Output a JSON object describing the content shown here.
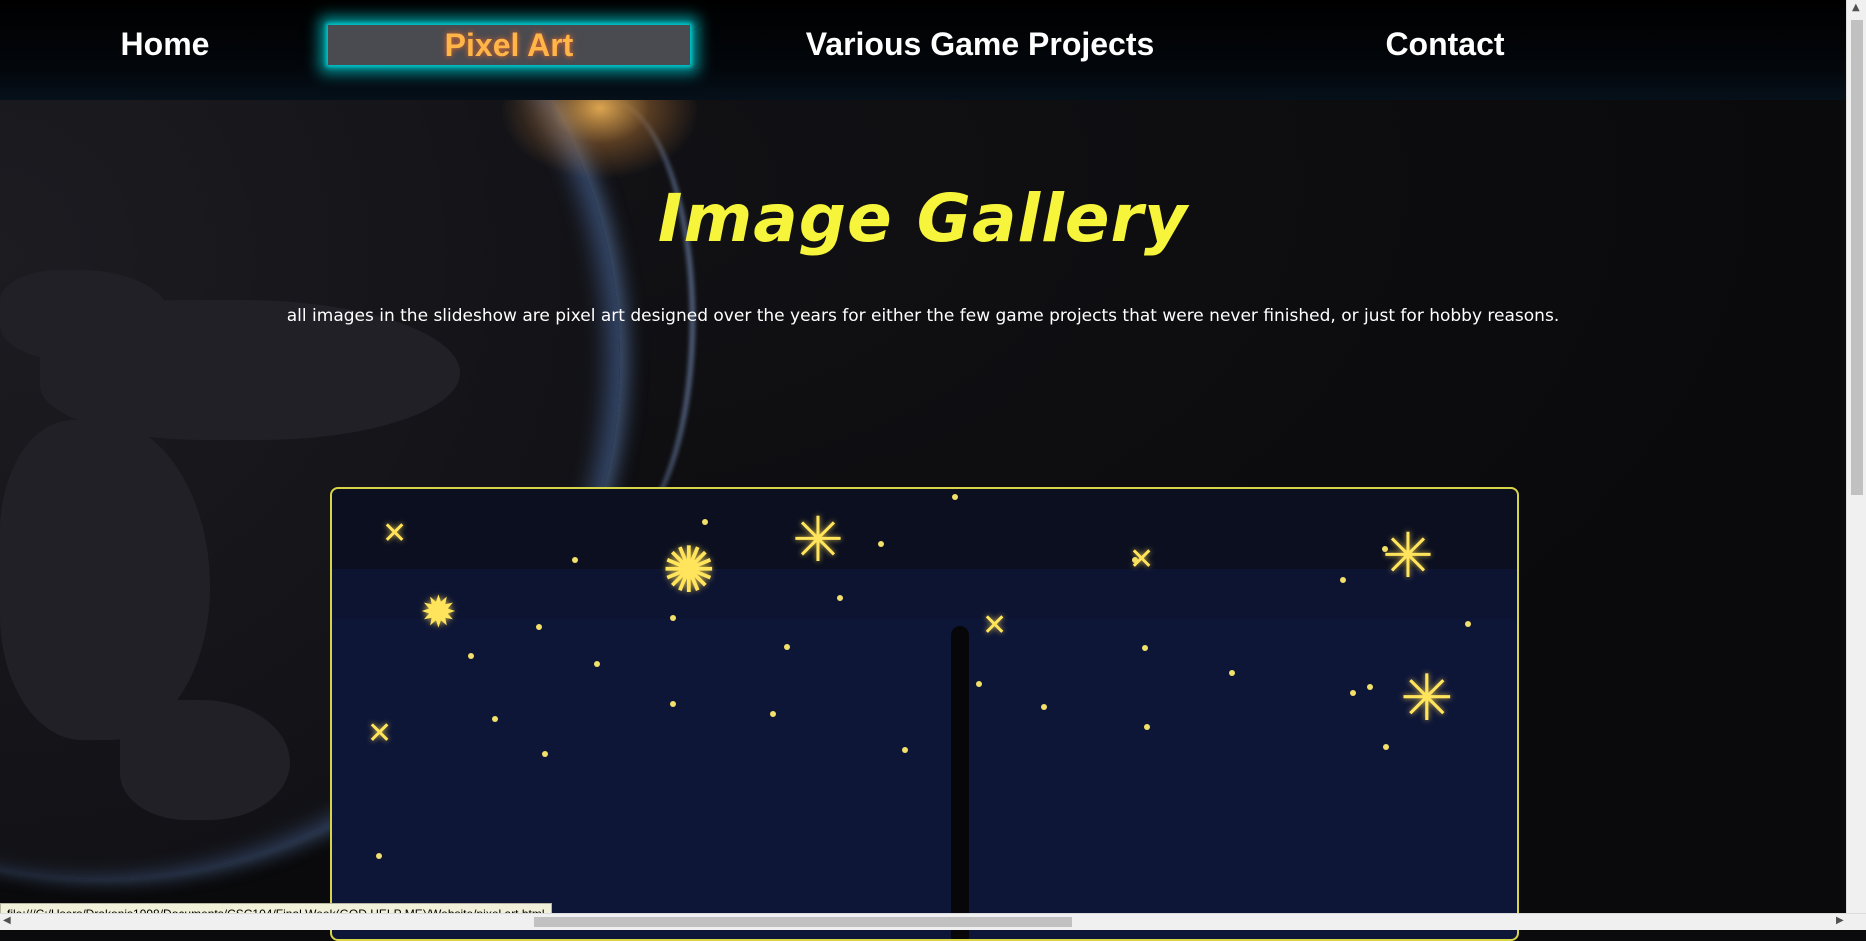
{
  "nav": {
    "items": [
      {
        "label": "Home",
        "active": false
      },
      {
        "label": "Pixel Art",
        "active": true
      },
      {
        "label": "Various Game Projects",
        "active": false
      },
      {
        "label": "Contact",
        "active": false
      }
    ]
  },
  "main": {
    "title": "Image Gallery",
    "description": "all images in the slideshow are pixel art designed over the years for either the few game projects that were never finished, or just for hobby reasons."
  },
  "slideshow": {
    "current_slide": "pixel art night sky with stars"
  },
  "status_bar": {
    "url": "file:///C:/Users/Drakonis1998/Documents/CSC104/Final Week(GOD HELP ME)/Website/pixel art.html"
  },
  "colors": {
    "accent": "#f6f53b",
    "active_nav_text": "#ffb547",
    "active_nav_glow": "#00c8cd",
    "slideshow_border": "#d8d448",
    "sky": "#0e1638"
  },
  "icons": {
    "scroll_up": "triangle-up",
    "scroll_down": "triangle-down",
    "scroll_left": "triangle-left",
    "scroll_right": "triangle-right"
  }
}
